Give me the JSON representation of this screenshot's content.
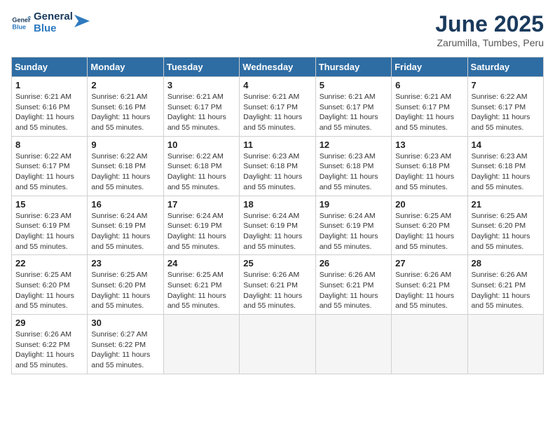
{
  "header": {
    "logo_line1": "General",
    "logo_line2": "Blue",
    "month_year": "June 2025",
    "location": "Zarumilla, Tumbes, Peru"
  },
  "days_of_week": [
    "Sunday",
    "Monday",
    "Tuesday",
    "Wednesday",
    "Thursday",
    "Friday",
    "Saturday"
  ],
  "weeks": [
    [
      {
        "day": "1",
        "sunrise": "6:21 AM",
        "sunset": "6:16 PM",
        "daylight": "11 hours and 55 minutes."
      },
      {
        "day": "2",
        "sunrise": "6:21 AM",
        "sunset": "6:16 PM",
        "daylight": "11 hours and 55 minutes."
      },
      {
        "day": "3",
        "sunrise": "6:21 AM",
        "sunset": "6:17 PM",
        "daylight": "11 hours and 55 minutes."
      },
      {
        "day": "4",
        "sunrise": "6:21 AM",
        "sunset": "6:17 PM",
        "daylight": "11 hours and 55 minutes."
      },
      {
        "day": "5",
        "sunrise": "6:21 AM",
        "sunset": "6:17 PM",
        "daylight": "11 hours and 55 minutes."
      },
      {
        "day": "6",
        "sunrise": "6:21 AM",
        "sunset": "6:17 PM",
        "daylight": "11 hours and 55 minutes."
      },
      {
        "day": "7",
        "sunrise": "6:22 AM",
        "sunset": "6:17 PM",
        "daylight": "11 hours and 55 minutes."
      }
    ],
    [
      {
        "day": "8",
        "sunrise": "6:22 AM",
        "sunset": "6:17 PM",
        "daylight": "11 hours and 55 minutes."
      },
      {
        "day": "9",
        "sunrise": "6:22 AM",
        "sunset": "6:18 PM",
        "daylight": "11 hours and 55 minutes."
      },
      {
        "day": "10",
        "sunrise": "6:22 AM",
        "sunset": "6:18 PM",
        "daylight": "11 hours and 55 minutes."
      },
      {
        "day": "11",
        "sunrise": "6:23 AM",
        "sunset": "6:18 PM",
        "daylight": "11 hours and 55 minutes."
      },
      {
        "day": "12",
        "sunrise": "6:23 AM",
        "sunset": "6:18 PM",
        "daylight": "11 hours and 55 minutes."
      },
      {
        "day": "13",
        "sunrise": "6:23 AM",
        "sunset": "6:18 PM",
        "daylight": "11 hours and 55 minutes."
      },
      {
        "day": "14",
        "sunrise": "6:23 AM",
        "sunset": "6:18 PM",
        "daylight": "11 hours and 55 minutes."
      }
    ],
    [
      {
        "day": "15",
        "sunrise": "6:23 AM",
        "sunset": "6:19 PM",
        "daylight": "11 hours and 55 minutes."
      },
      {
        "day": "16",
        "sunrise": "6:24 AM",
        "sunset": "6:19 PM",
        "daylight": "11 hours and 55 minutes."
      },
      {
        "day": "17",
        "sunrise": "6:24 AM",
        "sunset": "6:19 PM",
        "daylight": "11 hours and 55 minutes."
      },
      {
        "day": "18",
        "sunrise": "6:24 AM",
        "sunset": "6:19 PM",
        "daylight": "11 hours and 55 minutes."
      },
      {
        "day": "19",
        "sunrise": "6:24 AM",
        "sunset": "6:19 PM",
        "daylight": "11 hours and 55 minutes."
      },
      {
        "day": "20",
        "sunrise": "6:25 AM",
        "sunset": "6:20 PM",
        "daylight": "11 hours and 55 minutes."
      },
      {
        "day": "21",
        "sunrise": "6:25 AM",
        "sunset": "6:20 PM",
        "daylight": "11 hours and 55 minutes."
      }
    ],
    [
      {
        "day": "22",
        "sunrise": "6:25 AM",
        "sunset": "6:20 PM",
        "daylight": "11 hours and 55 minutes."
      },
      {
        "day": "23",
        "sunrise": "6:25 AM",
        "sunset": "6:20 PM",
        "daylight": "11 hours and 55 minutes."
      },
      {
        "day": "24",
        "sunrise": "6:25 AM",
        "sunset": "6:21 PM",
        "daylight": "11 hours and 55 minutes."
      },
      {
        "day": "25",
        "sunrise": "6:26 AM",
        "sunset": "6:21 PM",
        "daylight": "11 hours and 55 minutes."
      },
      {
        "day": "26",
        "sunrise": "6:26 AM",
        "sunset": "6:21 PM",
        "daylight": "11 hours and 55 minutes."
      },
      {
        "day": "27",
        "sunrise": "6:26 AM",
        "sunset": "6:21 PM",
        "daylight": "11 hours and 55 minutes."
      },
      {
        "day": "28",
        "sunrise": "6:26 AM",
        "sunset": "6:21 PM",
        "daylight": "11 hours and 55 minutes."
      }
    ],
    [
      {
        "day": "29",
        "sunrise": "6:26 AM",
        "sunset": "6:22 PM",
        "daylight": "11 hours and 55 minutes."
      },
      {
        "day": "30",
        "sunrise": "6:27 AM",
        "sunset": "6:22 PM",
        "daylight": "11 hours and 55 minutes."
      },
      null,
      null,
      null,
      null,
      null
    ]
  ]
}
